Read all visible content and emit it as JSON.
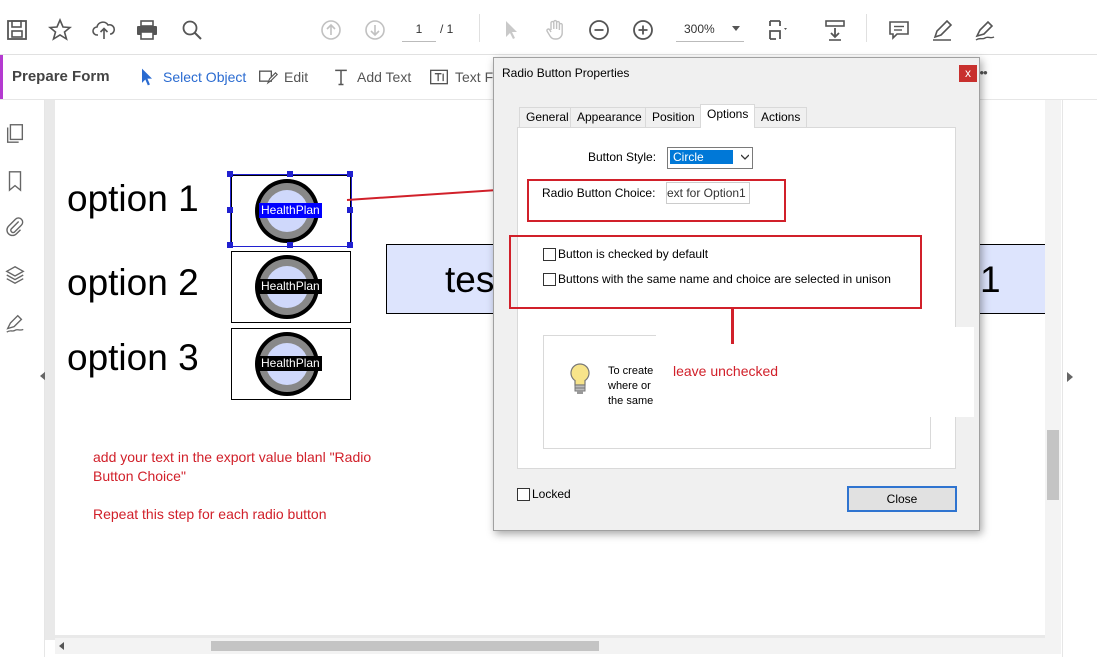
{
  "toolbar": {
    "page_current": "1",
    "page_total": "/ 1",
    "zoom": "300%",
    "icons": [
      "save-icon",
      "star-icon",
      "upload-icon",
      "print-icon",
      "search-icon",
      "arrow-up-icon",
      "arrow-down-icon",
      "pointer-icon",
      "hand-icon",
      "zoom-out-icon",
      "zoom-in-icon",
      "page-fit-icon",
      "scroll-mode-icon",
      "comment-icon",
      "pen-icon",
      "sign-icon"
    ]
  },
  "formbar": {
    "title": "Prepare Form",
    "select_object": "Select Object",
    "edit": "Edit",
    "add_text": "Add Text",
    "text_field": "Text Fi",
    "more": "•••"
  },
  "document": {
    "options": [
      "option 1",
      "option 2",
      "option 3"
    ],
    "field_names": [
      "HealthPlan",
      "HealthPlan",
      "HealthPlan"
    ],
    "banner_left": "tes",
    "banner_right": "1",
    "annotation_line1": "add your text in the export value blanl \"Radio",
    "annotation_line2": "Button Choice\"",
    "annotation_line3": "Repeat this step for each radio button",
    "annotation_leave": "leave unchecked"
  },
  "dialog": {
    "title": "Radio Button Properties",
    "close_x": "x",
    "tabs": [
      "General",
      "Appearance",
      "Position",
      "Options",
      "Actions"
    ],
    "active_tab": "Options",
    "button_style_label": "Button Style:",
    "button_style_value": "Circle",
    "choice_label": "Radio Button Choice:",
    "choice_value": "ext for Option1",
    "checked_default_label": "Button is checked by default",
    "unison_label": "Buttons with the same name and choice are selected in unison",
    "hint_line1": "To create",
    "hint_line2": "where or",
    "hint_line3": "the same",
    "locked_label": "Locked",
    "close_button": "Close"
  },
  "colors": {
    "accent_form": "#b43ad0",
    "annotation_red": "#d1202a",
    "selection_blue": "#0000ff",
    "banner_fill": "#dde4fd"
  }
}
